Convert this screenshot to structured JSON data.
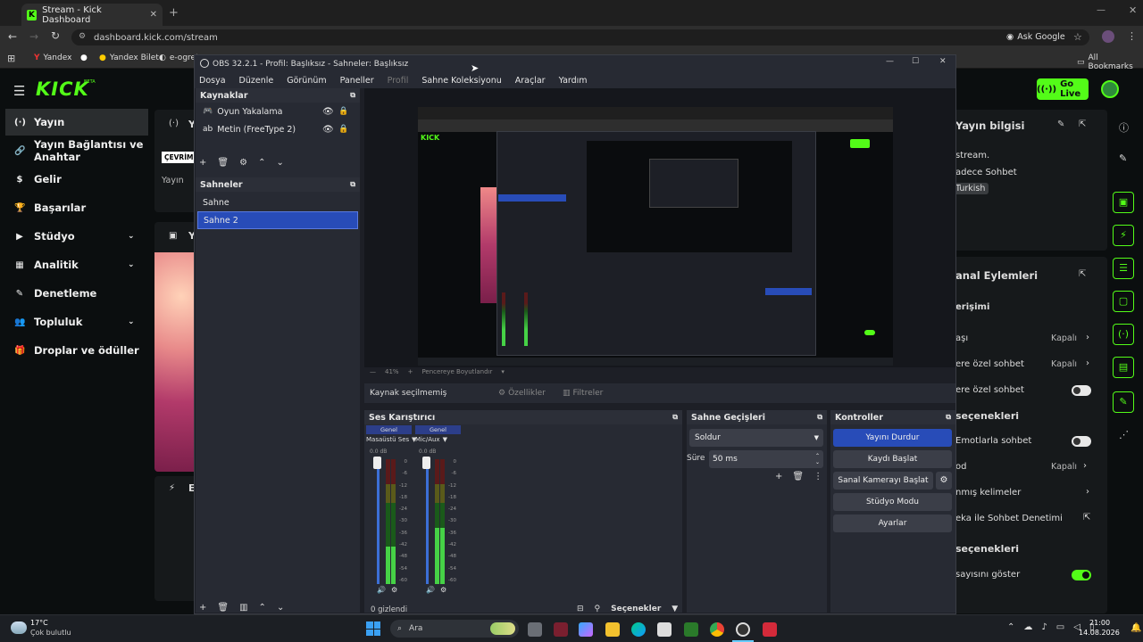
{
  "browser": {
    "tab_title": "Stream - Kick Dashboard",
    "url": "dashboard.kick.com/stream",
    "ask_google": "Ask Google",
    "bookmarks": [
      "Yandex",
      "Yandex Bilet",
      "e-ogret"
    ],
    "all_bookmarks": "All Bookmarks"
  },
  "kick": {
    "logo": "KICK",
    "logo_badge": "BETA",
    "sidebar": [
      {
        "label": "Yayın",
        "icon": "radio-icon",
        "active": true
      },
      {
        "label": "Yayın Bağlantısı ve Anahtar",
        "icon": "link-icon"
      },
      {
        "label": "Gelir",
        "icon": "dollar-icon"
      },
      {
        "label": "Başarılar",
        "icon": "trophy-icon"
      },
      {
        "label": "Stüdyo",
        "icon": "studio-icon",
        "chevron": true
      },
      {
        "label": "Analitik",
        "icon": "chart-icon",
        "chevron": true
      },
      {
        "label": "Denetleme",
        "icon": "hammer-icon"
      },
      {
        "label": "Topluluk",
        "icon": "users-icon",
        "chevron": true
      },
      {
        "label": "Droplar ve ödüller",
        "icon": "gift-icon"
      }
    ],
    "center": {
      "card1_title": "Y",
      "badge": "ÇEVRİM",
      "card1_text": "Yayın",
      "card2_title": "Y",
      "card3_title": "E"
    },
    "go_live": "Go Live",
    "right": {
      "stream_info": "Yayın bilgisi",
      "info_line1": "stream.",
      "info_line2": "adece Sohbet",
      "language": "Turkish",
      "actions_title": "anal Eylemleri",
      "access_title": "erişimi",
      "rows": [
        {
          "label": "aşı",
          "value": "Kapalı"
        },
        {
          "label": "ere özel sohbet",
          "value": "Kapalı"
        },
        {
          "label": "ere özel sohbet",
          "toggle": false
        }
      ],
      "options_title": "seçenekleri",
      "rows2": [
        {
          "label": "Emotlarla sohbet",
          "toggle": false
        },
        {
          "label": "od",
          "value": "Kapalı"
        },
        {
          "label": "nmış kelimeler"
        },
        {
          "label": "eka ile Sohbet Denetimi"
        }
      ],
      "options2_title": "seçenekleri",
      "viewer_count": "sayısını göster",
      "viewer_toggle": true
    }
  },
  "obs": {
    "title": "OBS 32.2.1 - Profil: Başlıksız - Sahneler: Başlıksız",
    "menu": [
      "Dosya",
      "Düzenle",
      "Görünüm",
      "Paneller",
      "Profil",
      "Sahne Koleksiyonu",
      "Araçlar",
      "Yardım"
    ],
    "sources_title": "Kaynaklar",
    "sources": [
      "Oyun Yakalama",
      "Metin (FreeType 2)"
    ],
    "scenes_title": "Sahneler",
    "scenes": [
      "Sahne",
      "Sahne 2"
    ],
    "selected_scene": "Sahne 2",
    "preview_zoom": "41%",
    "preview_fit": "Pencereye Boyutlandır",
    "no_source": "Kaynak seçilmemiş",
    "properties": "Özellikler",
    "filters": "Filtreler",
    "mixer_title": "Ses Karıştırıcı",
    "channels": [
      {
        "tag": "Genel",
        "name": "Masaüstü Ses",
        "db": "0.0 dB",
        "level": 0.3
      },
      {
        "tag": "Genel",
        "name": "Mic/Aux",
        "db": "0.0 dB",
        "level": 0.45
      }
    ],
    "ticks": [
      "0",
      "-6",
      "-12",
      "-18",
      "-24",
      "-30",
      "-36",
      "-42",
      "-48",
      "-54",
      "-60"
    ],
    "transitions_title": "Sahne Geçişleri",
    "transition": "Soldur",
    "duration_label": "Süre",
    "duration": "50 ms",
    "controls_title": "Kontroller",
    "controls": [
      "Yayını Durdur",
      "Kaydı Başlat",
      "Sanal Kamerayı Başlat",
      "Stüdyo Modu",
      "Ayarlar"
    ],
    "hidden_count": "0 gizlendi",
    "options": "Seçenekler"
  },
  "taskbar": {
    "weather_temp": "17°C",
    "weather_desc": "Çok bulutlu",
    "search": "Ara",
    "time": "21:00",
    "date": "14.08.2026"
  },
  "colors": {
    "kick_green": "#53fc18",
    "obs_blue": "#284cb8"
  }
}
